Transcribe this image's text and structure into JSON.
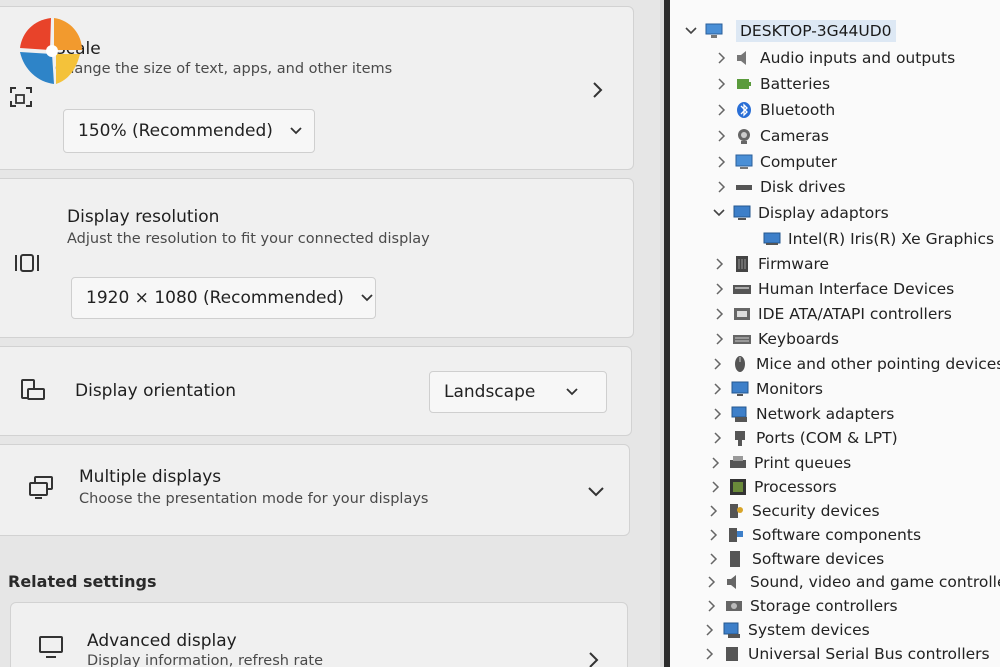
{
  "settings": {
    "scale": {
      "title": "Scale",
      "subtitle": "Change the size of text, apps, and other items",
      "value": "150% (Recommended)"
    },
    "resolution": {
      "title": "Display resolution",
      "subtitle": "Adjust the resolution to fit your connected display",
      "value": "1920 × 1080 (Recommended)"
    },
    "orientation": {
      "title": "Display orientation",
      "value": "Landscape"
    },
    "multiple": {
      "title": "Multiple displays",
      "subtitle": "Choose the presentation mode for your displays"
    },
    "related_heading": "Related settings",
    "advanced": {
      "title": "Advanced display",
      "subtitle": "Display information, refresh rate"
    }
  },
  "device_manager": {
    "root": "DESKTOP-3G44UD0",
    "items": [
      {
        "label": "Audio inputs and outputs",
        "icon": "speaker-icon"
      },
      {
        "label": "Batteries",
        "icon": "battery-icon"
      },
      {
        "label": "Bluetooth",
        "icon": "bluetooth-icon"
      },
      {
        "label": "Cameras",
        "icon": "camera-icon"
      },
      {
        "label": "Computer",
        "icon": "computer-icon"
      },
      {
        "label": "Disk drives",
        "icon": "disk-drive-icon"
      },
      {
        "label": "Display adaptors",
        "icon": "display-adapter-icon",
        "expanded": true
      },
      {
        "label": "Intel(R) Iris(R) Xe Graphics",
        "icon": "display-adapter-icon",
        "child": true
      },
      {
        "label": "Firmware",
        "icon": "firmware-icon"
      },
      {
        "label": "Human Interface Devices",
        "icon": "hid-icon"
      },
      {
        "label": "IDE ATA/ATAPI controllers",
        "icon": "ide-controller-icon"
      },
      {
        "label": "Keyboards",
        "icon": "keyboard-icon"
      },
      {
        "label": "Mice and other pointing devices",
        "icon": "mouse-icon"
      },
      {
        "label": "Monitors",
        "icon": "monitor-icon"
      },
      {
        "label": "Network adapters",
        "icon": "network-adapter-icon"
      },
      {
        "label": "Ports (COM & LPT)",
        "icon": "port-icon"
      },
      {
        "label": "Print queues",
        "icon": "printer-icon"
      },
      {
        "label": "Processors",
        "icon": "processor-icon"
      },
      {
        "label": "Security devices",
        "icon": "security-device-icon"
      },
      {
        "label": "Software components",
        "icon": "software-component-icon"
      },
      {
        "label": "Software devices",
        "icon": "software-device-icon"
      },
      {
        "label": "Sound, video and game controllers",
        "icon": "sound-controller-icon"
      },
      {
        "label": "Storage controllers",
        "icon": "storage-controller-icon"
      },
      {
        "label": "System devices",
        "icon": "system-device-icon"
      },
      {
        "label": "Universal Serial Bus controllers",
        "icon": "usb-icon"
      }
    ]
  }
}
